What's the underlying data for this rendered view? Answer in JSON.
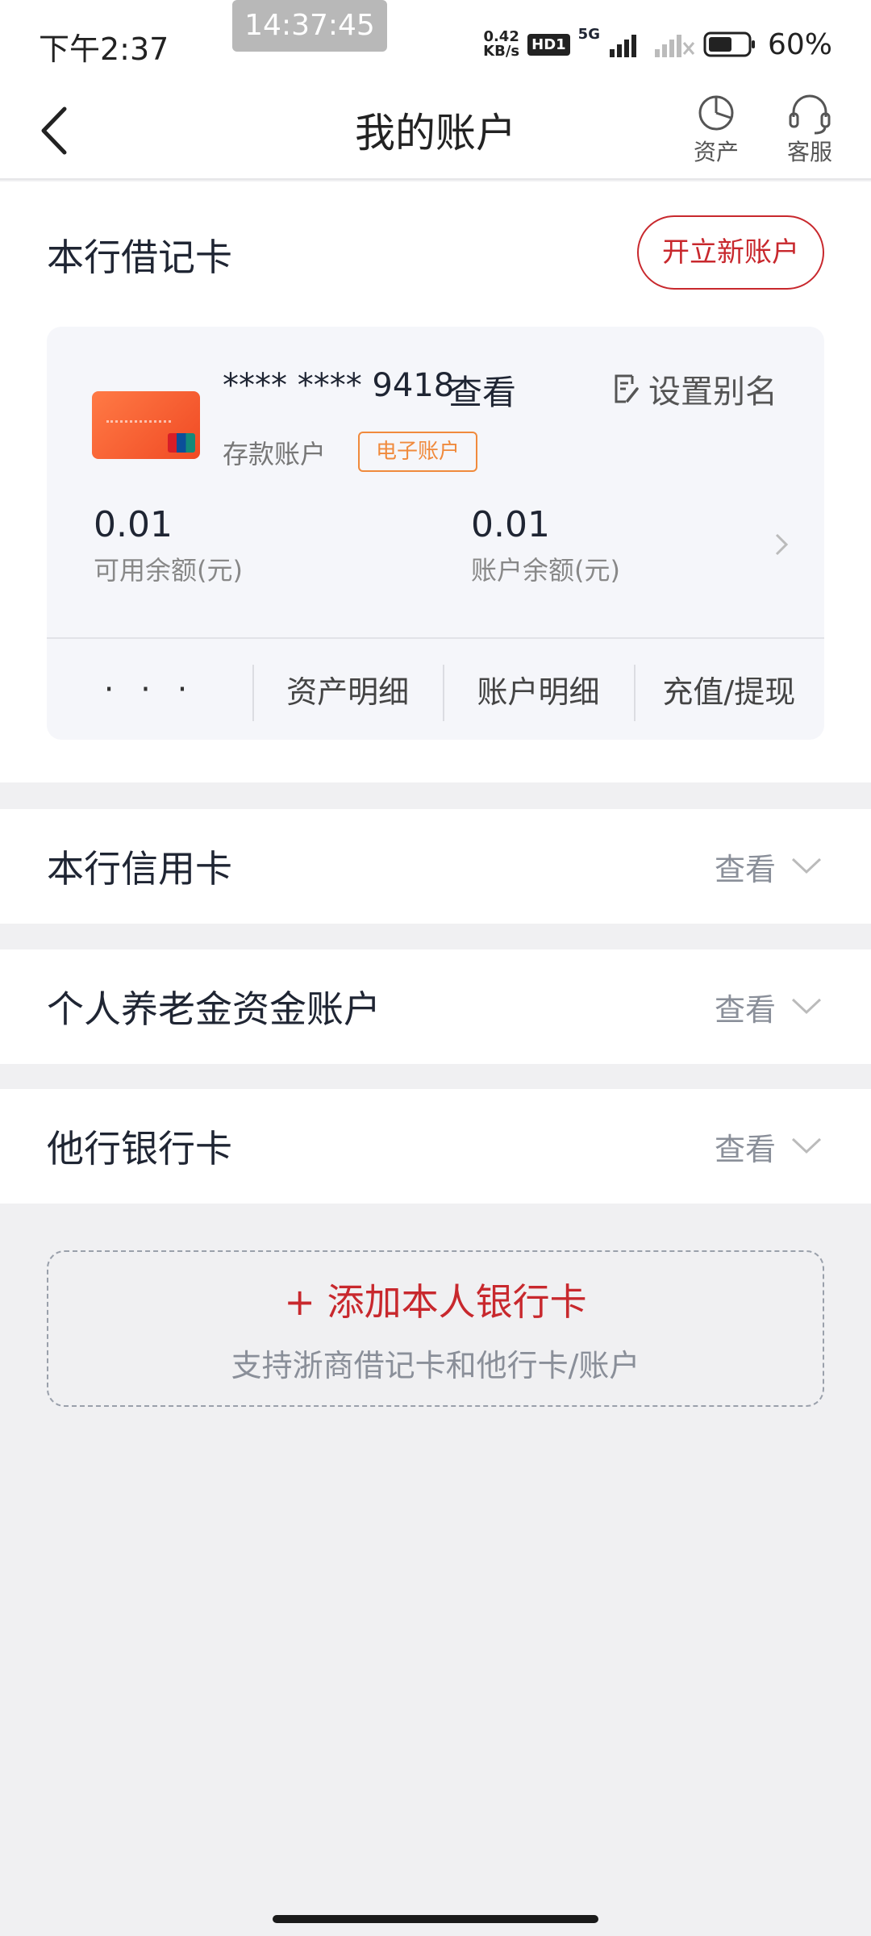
{
  "status_bar": {
    "time": "下午2:37",
    "overlay_time": "14:37:45",
    "net_speed_value": "0.42",
    "net_speed_unit": "KB/s",
    "hd_badge": "HD1",
    "network": "5G",
    "battery": "60%"
  },
  "nav": {
    "title": "我的账户",
    "assets_label": "资产",
    "service_label": "客服"
  },
  "debit": {
    "section_title": "本行借记卡",
    "open_account_label": "开立新账户",
    "card": {
      "number_masked": "**** **** 9418",
      "view_label": "查看",
      "alias_label": "设置别名",
      "account_type": "存款账户",
      "tag": "电子账户",
      "available_balance_value": "0.01",
      "available_balance_label": "可用余额(元)",
      "account_balance_value": "0.01",
      "account_balance_label": "账户余额(元)",
      "actions": {
        "more": "· · ·",
        "asset_detail": "资产明细",
        "account_detail": "账户明细",
        "topup_withdraw": "充值/提现"
      }
    }
  },
  "sections": [
    {
      "title": "本行信用卡",
      "action": "查看"
    },
    {
      "title": "个人养老金资金账户",
      "action": "查看"
    },
    {
      "title": "他行银行卡",
      "action": "查看"
    }
  ],
  "add_card": {
    "title": "+ 添加本人银行卡",
    "subtitle": "支持浙商借记卡和他行卡/账户"
  },
  "colors": {
    "accent_red": "#c8282d",
    "tag_orange": "#f08a3c",
    "background": "#f0f0f2"
  }
}
